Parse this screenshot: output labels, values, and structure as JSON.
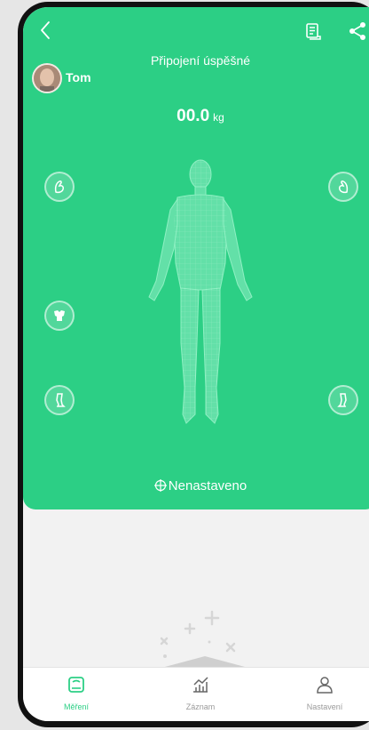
{
  "header": {
    "status": "Připojení úspěšné",
    "back_icon": "chevron-left-icon",
    "history_icon": "record-list-icon",
    "share_icon": "share-icon"
  },
  "user": {
    "name": "Tom"
  },
  "measurement": {
    "value": "00.0",
    "unit": "kg"
  },
  "segments": {
    "left": [
      "left-arm-icon",
      "trunk-icon",
      "left-leg-icon"
    ],
    "right": [
      "right-arm-icon",
      "right-leg-icon"
    ]
  },
  "goal": {
    "label": "Nenastaveno"
  },
  "tabs": [
    {
      "label": "Měření",
      "icon": "scale-icon",
      "active": true
    },
    {
      "label": "Záznam",
      "icon": "chart-icon",
      "active": false
    },
    {
      "label": "Nastavení",
      "icon": "person-icon",
      "active": false
    }
  ],
  "colors": {
    "primary": "#2ccf85",
    "background": "#f2f2f2",
    "inactive": "#9a9a9a"
  }
}
